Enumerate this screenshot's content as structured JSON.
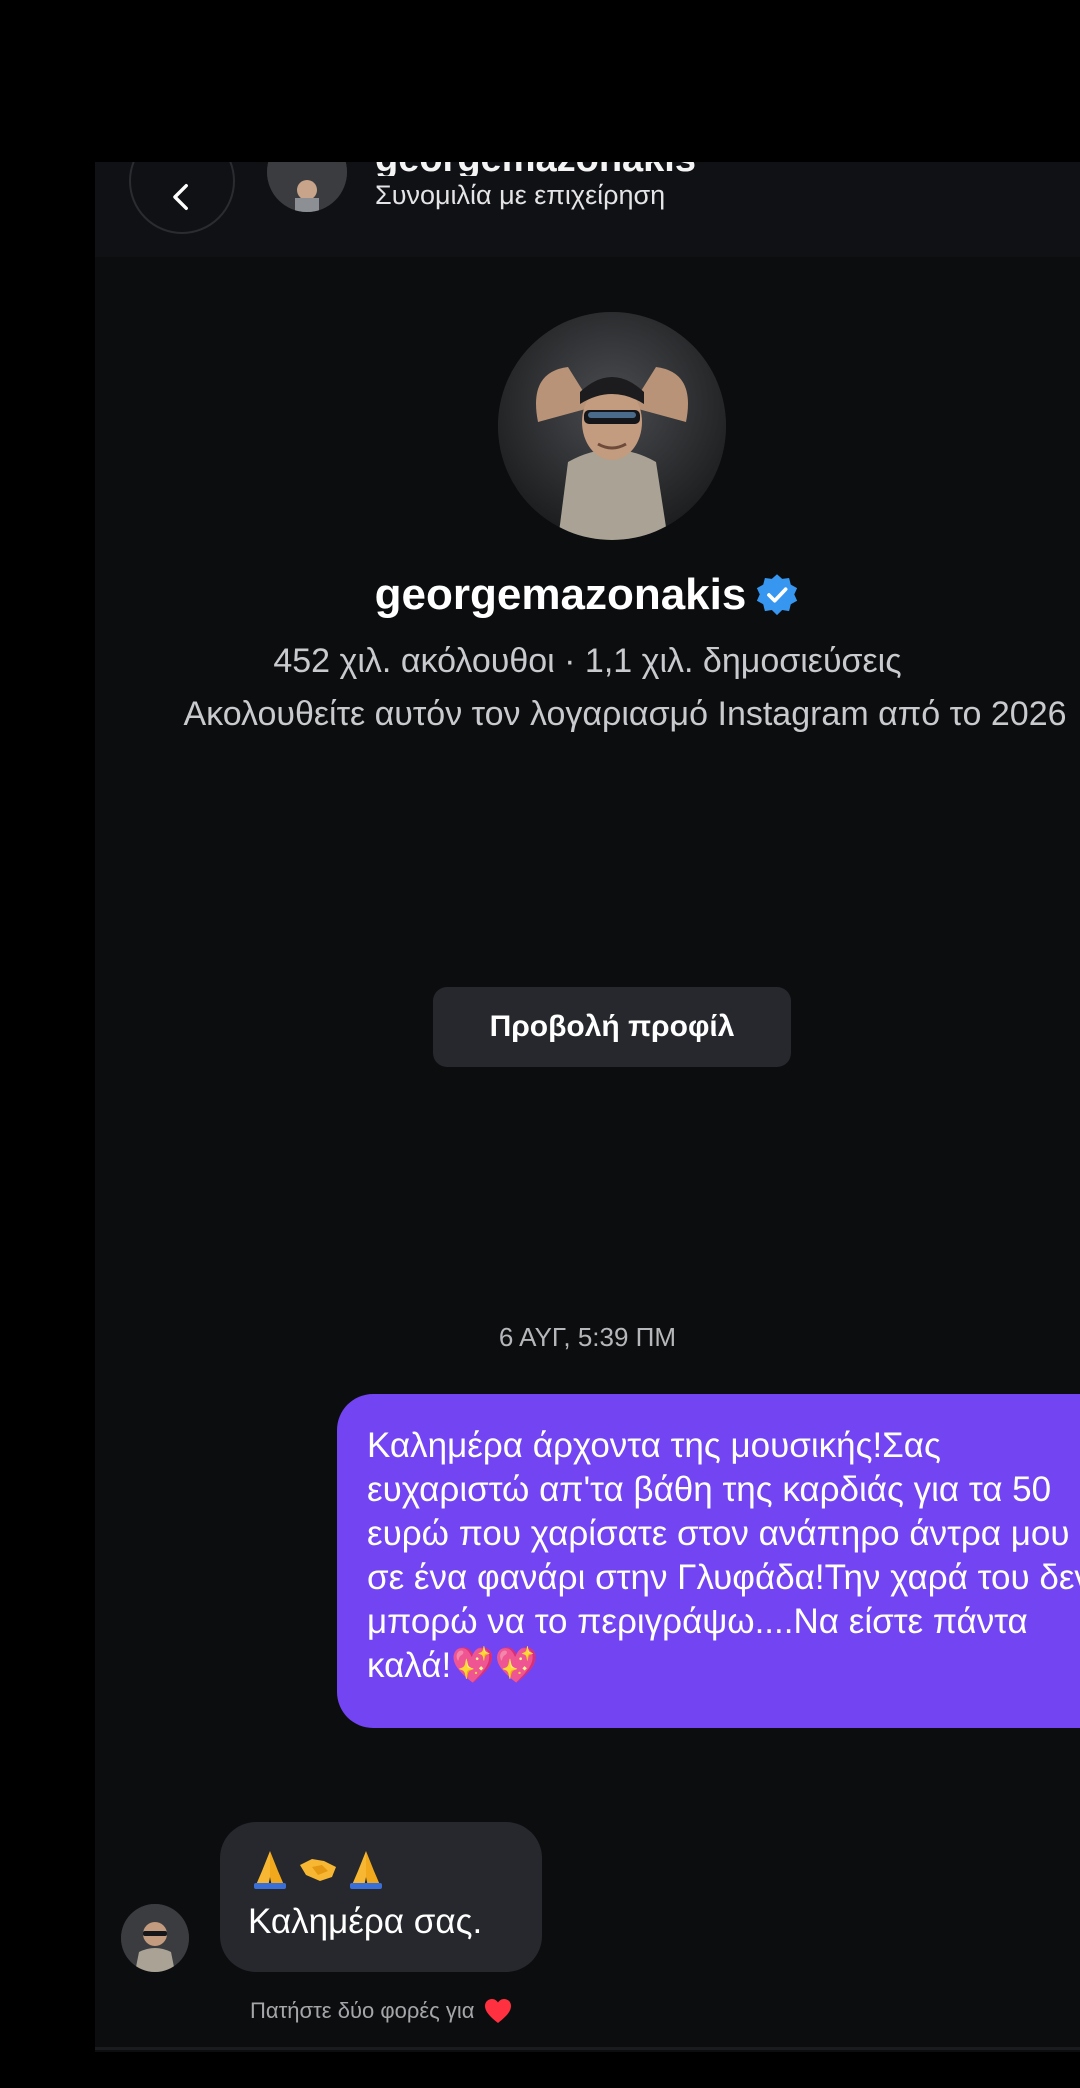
{
  "header": {
    "name": "georgemazonakis",
    "subtitle": "Συνομιλία με επιχείρηση",
    "back_icon": "chevron-left-icon"
  },
  "profile": {
    "username": "georgemazonakis",
    "verified": true,
    "stats": "452 χιλ. ακόλουθοι · 1,1 χιλ. δημοσιεύσεις",
    "follow_info": "Ακολουθείτε αυτόν τον λογαριασμό Instagram από το 2026",
    "view_profile_label": "Προβολή προφίλ"
  },
  "conversation": {
    "timestamp": "6 ΑΥΓ, 5:39 ΠΜ",
    "outgoing_message": "Καλημέρα άρχοντα της μουσικής!Σας ευχαριστώ απ'τα βάθη της καρδιάς για τα 50 ευρώ που χαρίσατε στον ανάπηρο άντρα μου σε ένα φανάρι στην Γλυφάδα!Την χαρά του δεν μπορώ να το περιγράψω....Να είστε πάντα καλά!💖💖",
    "incoming_emojis": [
      "folded-hands-icon",
      "handshake-icon",
      "folded-hands-icon"
    ],
    "incoming_message": "Καλημέρα σας.",
    "tap_hint": "Πατήστε δύο φορές για"
  },
  "colors": {
    "background": "#0c0d0f",
    "outgoing_bubble": "#7344f2",
    "incoming_bubble": "#26282d",
    "verified": "#3797f0",
    "heart": "#ff3040"
  }
}
